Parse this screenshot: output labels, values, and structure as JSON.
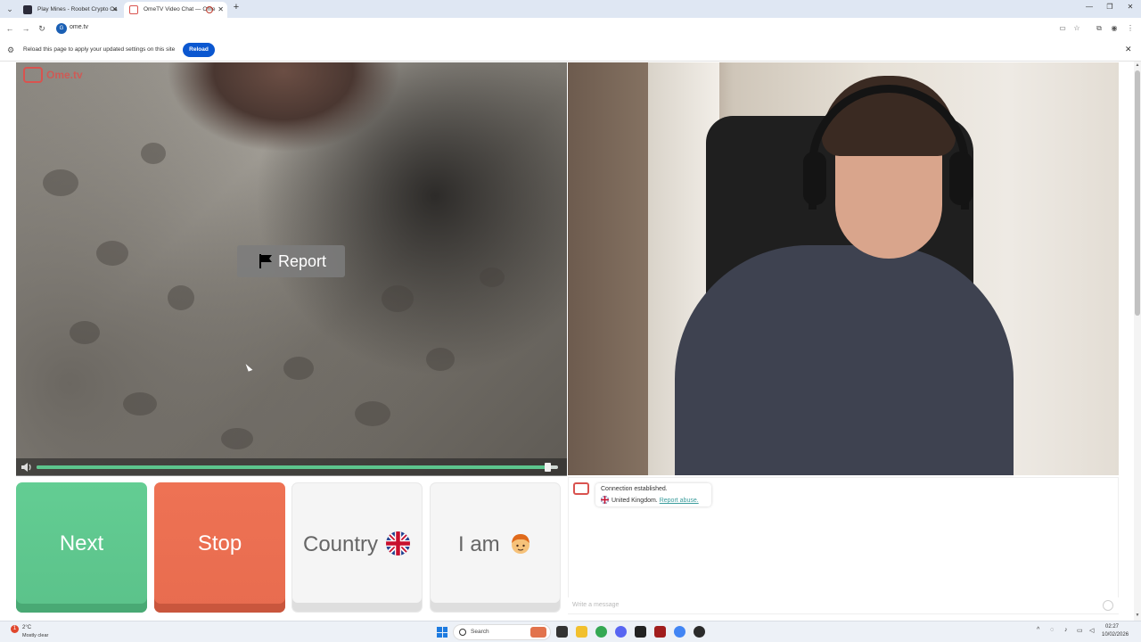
{
  "browser": {
    "tabs": [
      {
        "title": "Play Mines - Roobet Crypto Ca",
        "active": false
      },
      {
        "title": "OmeTV Video Chat — Ome",
        "active": true
      }
    ],
    "url": "ome.tv",
    "site_badge": "G"
  },
  "infobar": {
    "message": "Reload this page to apply your updated settings on this site",
    "reload_label": "Reload"
  },
  "logo": {
    "text": "Ome.tv"
  },
  "video": {
    "report_label": "Report",
    "volume_level": 0.98
  },
  "controls": {
    "next_label": "Next",
    "stop_label": "Stop",
    "country_label": "Country",
    "iam_label": "I am"
  },
  "chat": {
    "status": "Connection established.",
    "country": "United Kingdom.",
    "report_abuse": "Report abuse.",
    "placeholder": "Write a message"
  },
  "taskbar": {
    "weather_temp": "2°C",
    "weather_desc": "Mostly clear",
    "weather_badge": "1",
    "search_label": "Search",
    "time": "02:27",
    "date": "10/02/2026"
  },
  "colors": {
    "next": "#5bc28a",
    "stop": "#e86c4f",
    "accent_blue": "#0b57d0",
    "brand_red": "#d9534f",
    "volume_fill": "#5cc58d"
  },
  "icons": [
    "tab-menu-icon",
    "back-icon",
    "forward-icon",
    "refresh-icon",
    "gear-icon",
    "flag-icon",
    "speaker-icon",
    "uk-flag-icon",
    "boy-face-icon",
    "emoji-icon",
    "search-icon",
    "windows-start-icon"
  ]
}
